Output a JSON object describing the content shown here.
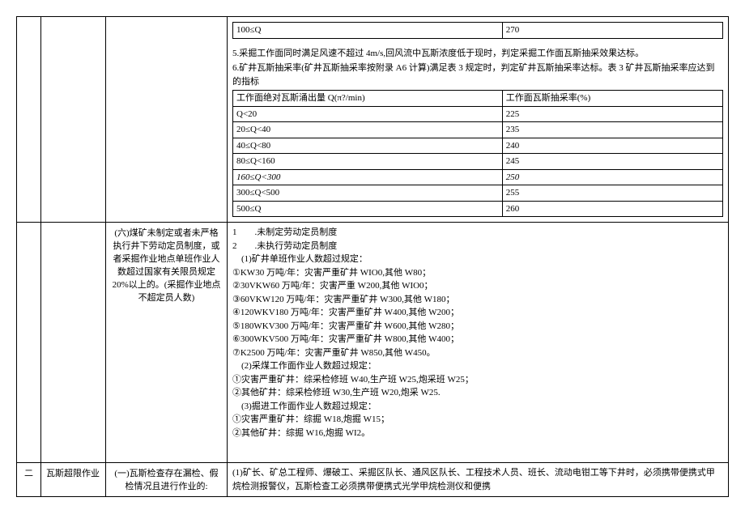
{
  "row1": {
    "inner1": {
      "c0": "100≤Q",
      "v0": "270"
    },
    "para5": "5.采掘工作面同时满足风速不超过 4m/s,回风流中瓦斯浓度低于现时，判定采掘工作面瓦斯抽采效果达标。",
    "para6": "6.矿井瓦斯抽采率(矿井瓦斯抽采率按附录 A6 计算)满足表 3 规定时，判定矿井瓦斯抽采率达标。表 3 矿井瓦斯抽采率应达到的指标",
    "table2": {
      "h1": "工作面绝对瓦斯涌出量 Q(π?/min)",
      "h2": "工作面瓦斯抽采率(%)",
      "rows": [
        {
          "c": "Q<20",
          "v": "225"
        },
        {
          "c": "20≤Q<40",
          "v": "235"
        },
        {
          "c": "40≤Q<80",
          "v": "240"
        },
        {
          "c": "80≤Q<160",
          "v": "245"
        },
        {
          "c": "160≤Q<300",
          "v": "250"
        },
        {
          "c": "300≤Q<500",
          "v": "255"
        },
        {
          "c": "500≤Q",
          "v": "260"
        }
      ]
    }
  },
  "row2": {
    "col3": "(六)煤矿未制定或者未严格执行井下劳动定员制度，或者采掘作业地点单班作业人数超过国家有关限员规定 20%以上的。(采掘作业地点不超定员人数)",
    "lines": [
      "1　　.未制定劳动定员制度",
      "2　　.未执行劳动定员制度",
      "　(1)矿井单班作业人数超过规定：",
      "①KW30 万吨/年：灾害严重矿井 WIO0,其他 W80；",
      "②30VKW60 万吨/年：灾害严重 W200,其他 WIO0；",
      "③60VKW120 万吨/年：灾害严重矿井 W300,其他 W180；",
      "④120WKV180 万吨/年：灾害严重矿井 W400,其他 W200；",
      "⑤180WKV300 万吨/年：灾害严重矿井 W600,其他 W280；",
      "⑥300WKV500 万吨/年：灾害严重矿井 W800,其他 W400；",
      "⑦K2500 万吨/年：灾害严重矿井 W850,其他 W450。",
      "　(2)采煤工作面作业人数超过规定：",
      "①灾害严重矿井：综采检修班 W40,生产班 W25,炮采班 W25；",
      "②其他矿井：综采检修班 W30,生产班 W20,炮采 W25.",
      "　(3)掘进工作面作业人数超过规定：",
      "①灾害严重矿井：综掘 W18,炮掘 W15；",
      "②其他矿井：综掘 W16,炮掘 WI2。"
    ]
  },
  "row3": {
    "col1": "二",
    "col2": "瓦斯超限作业",
    "col3": "(一)瓦斯检查存在漏检、假检情况且进行作业的:",
    "col4": "(1)矿长、矿总工程师、爆破工、采掘区队长、通风区队长、工程技术人员、班长、流动电钳工等下井时，必须携带便携式甲烷检测报警仪，瓦斯检查工必须携带便携式光学甲烷检测仪和便携"
  }
}
